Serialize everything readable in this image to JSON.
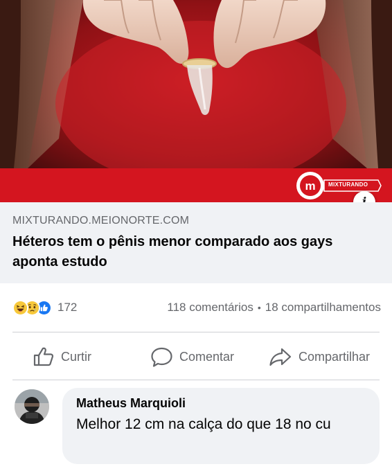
{
  "preview": {
    "brand_text": "MIXTURANDO",
    "info_label": "i",
    "domain": "MIXTURANDO.MEIONORTE.COM",
    "title": "Héteros tem o pênis menor comparado aos gays aponta estudo",
    "colors": {
      "brand_red": "#d4151f",
      "caption_bg": "#f0f2f5"
    }
  },
  "stats": {
    "reactions": [
      "haha",
      "sad",
      "like"
    ],
    "reaction_count": "172",
    "comments": "118 comentários",
    "separator": "•",
    "shares": "18 compartilhamentos"
  },
  "actions": {
    "like": {
      "label": "Curtir",
      "icon": "thumbs-up-icon"
    },
    "comment": {
      "label": "Comentar",
      "icon": "speech-bubble-icon"
    },
    "share": {
      "label": "Compartilhar",
      "icon": "share-arrow-icon"
    }
  },
  "comment": {
    "author": "Matheus Marquioli",
    "text": "Melhor 12 cm na calça do que 18 no cu"
  }
}
